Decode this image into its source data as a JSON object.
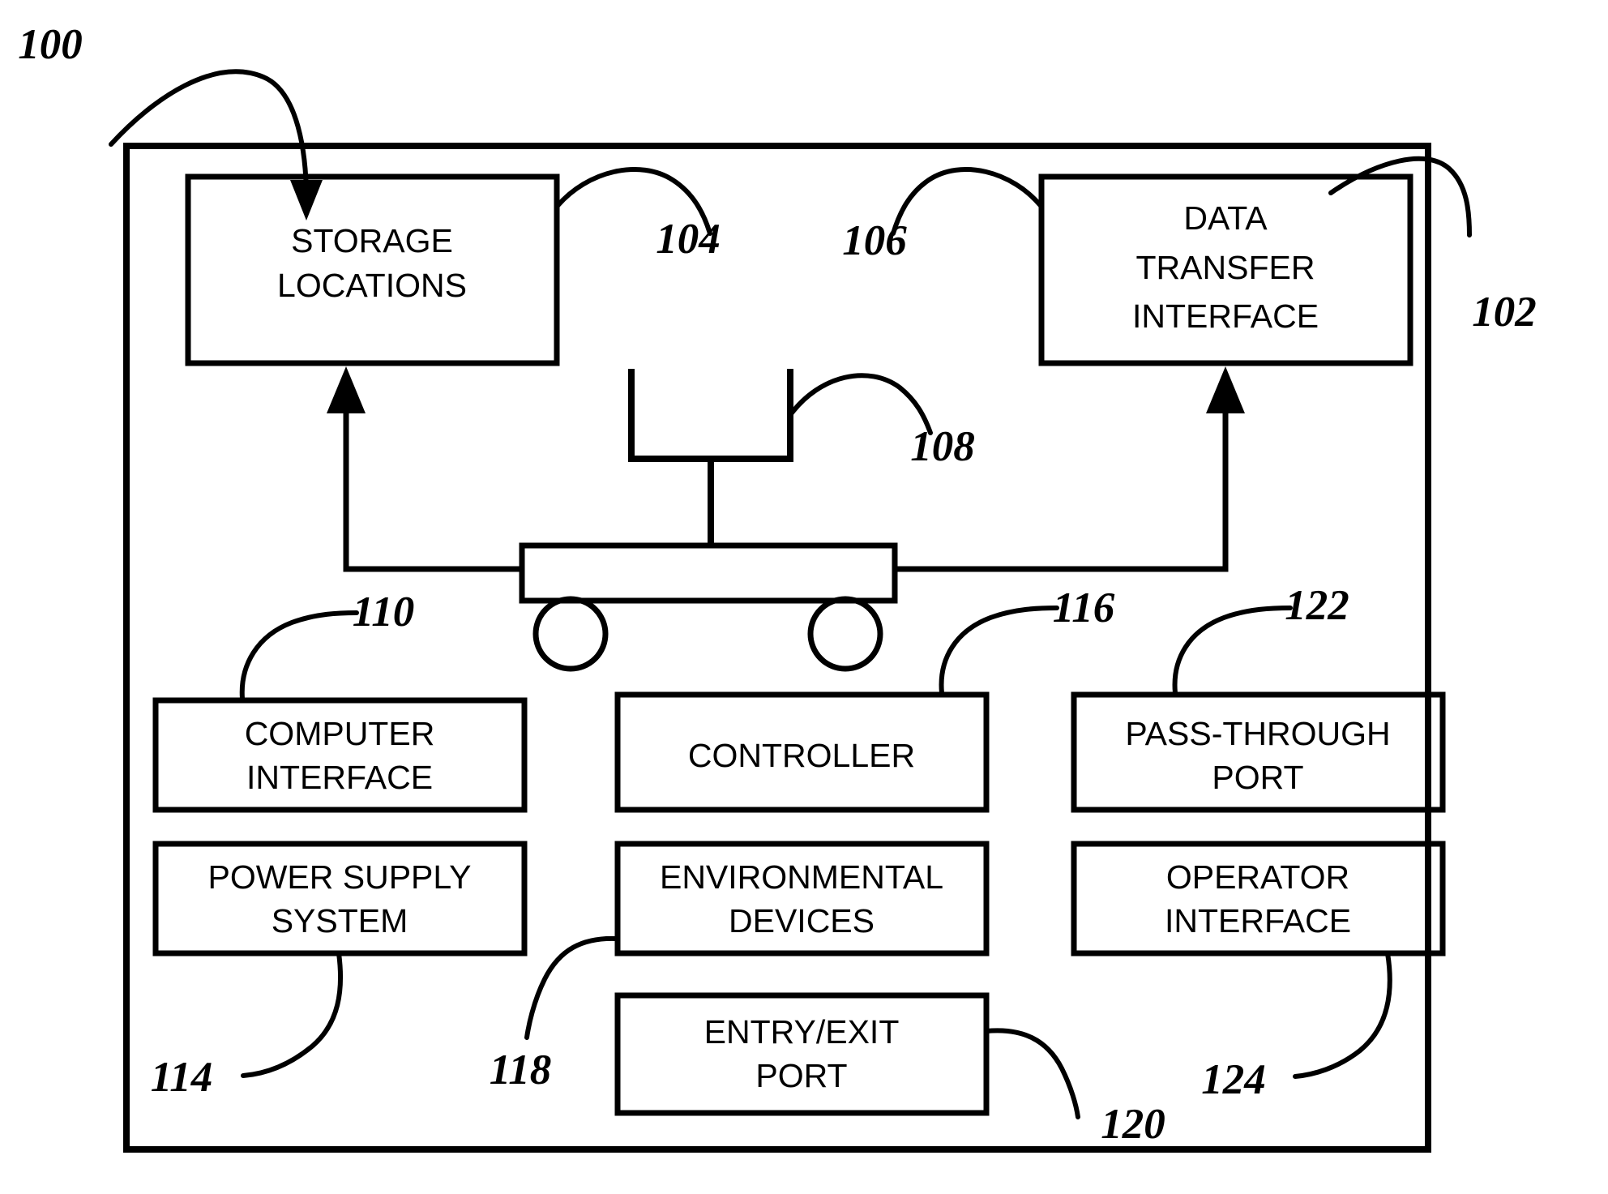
{
  "figure": {
    "title_ref": "100",
    "enclosure_ref": "102",
    "boxes": [
      {
        "id": "storage-locations",
        "ref": "104",
        "lines": [
          "STORAGE",
          "LOCATIONS"
        ]
      },
      {
        "id": "data-transfer-interface",
        "ref": "106",
        "lines": [
          "DATA",
          "TRANSFER",
          "INTERFACE"
        ]
      },
      {
        "id": "computer-interface",
        "ref": "110",
        "lines": [
          "COMPUTER",
          "INTERFACE"
        ]
      },
      {
        "id": "power-supply-system",
        "ref": "114",
        "lines": [
          "POWER SUPPLY",
          "SYSTEM"
        ]
      },
      {
        "id": "controller",
        "ref": "116",
        "lines": [
          "CONTROLLER"
        ]
      },
      {
        "id": "environmental-devices",
        "ref": "118",
        "lines": [
          "ENVIRONMENTAL",
          "DEVICES"
        ]
      },
      {
        "id": "entry-exit-port",
        "ref": "120",
        "lines": [
          "ENTRY/EXIT",
          "PORT"
        ]
      },
      {
        "id": "pass-through-port",
        "ref": "122",
        "lines": [
          "PASS-THROUGH",
          "PORT"
        ]
      },
      {
        "id": "operator-interface",
        "ref": "124",
        "lines": [
          "OPERATOR",
          "INTERFACE"
        ]
      }
    ],
    "robot": {
      "id": "robotic-transport-mechanism",
      "ref": "108"
    },
    "ref_labels": {
      "r100": "100",
      "r102": "102",
      "r104": "104",
      "r106": "106",
      "r108": "108",
      "r110": "110",
      "r114": "114",
      "r116": "116",
      "r118": "118",
      "r120": "120",
      "r122": "122",
      "r124": "124"
    },
    "box_text": {
      "storage_l1": "STORAGE",
      "storage_l2": "LOCATIONS",
      "dti_l1": "DATA",
      "dti_l2": "TRANSFER",
      "dti_l3": "INTERFACE",
      "ci_l1": "COMPUTER",
      "ci_l2": "INTERFACE",
      "pss_l1": "POWER SUPPLY",
      "pss_l2": "SYSTEM",
      "ctrl_l1": "CONTROLLER",
      "env_l1": "ENVIRONMENTAL",
      "env_l2": "DEVICES",
      "eep_l1": "ENTRY/EXIT",
      "eep_l2": "PORT",
      "ptp_l1": "PASS-THROUGH",
      "ptp_l2": "PORT",
      "oi_l1": "OPERATOR",
      "oi_l2": "INTERFACE"
    },
    "colors": {
      "stroke": "#000000",
      "background": "#ffffff"
    }
  }
}
